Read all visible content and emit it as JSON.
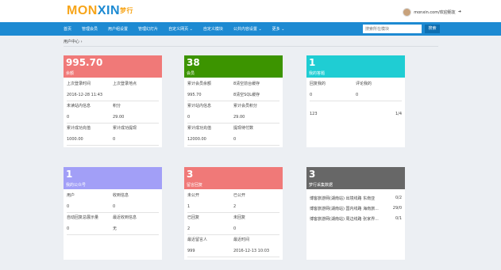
{
  "colors": {
    "nav": "#1d8ad2",
    "red": "#f07978",
    "green": "#3c9400",
    "teal": "#1fcdd3",
    "purple": "#a29ff7",
    "gray": "#676767"
  },
  "header": {
    "logo_part1": "MON",
    "logo_part2": "XIN",
    "logo_part3": "梦行",
    "user": "monxin.com/欢迎朋友",
    "user_icon": "logout-icon"
  },
  "nav": {
    "items": [
      "首页",
      "管理会员",
      "用户组设置",
      "管理幻灯片",
      "自定义网页 ⌄",
      "自定义模块",
      "公共内容设置 ⌄",
      "更多 ⌄"
    ],
    "search_placeholder": "搜索所在模块",
    "search_button": "搜索"
  },
  "breadcrumb": "用户中心 ›",
  "cards": [
    {
      "num": "995.70",
      "title": "余额",
      "color": "red",
      "rows": [
        [
          "上次登录时间",
          "上次登录地点"
        ],
        [
          "2016-12-28 11:43",
          ""
        ],
        [
          "未读站内信息",
          "积分"
        ],
        [
          "0",
          "29.00"
        ],
        [
          "累计成功充值",
          "累计成功提现"
        ],
        [
          "1000.00",
          "0"
        ]
      ]
    },
    {
      "num": "38",
      "title": "会员",
      "color": "green",
      "rows": [
        [
          "累计会员余额",
          "8清空前台缓存"
        ],
        [
          "995.70",
          "8清空SQL缓存"
        ],
        [
          "累计站内信息",
          "累计会员积分"
        ],
        [
          "0",
          "29.00"
        ],
        [
          "累计成功充值",
          "提现待付数"
        ],
        [
          "12000.00",
          "0"
        ]
      ]
    },
    {
      "num": "1",
      "title": "我的答题",
      "color": "teal",
      "rows": [
        [
          "回复我的",
          "评论我的"
        ],
        [
          "0",
          "0"
        ]
      ],
      "footer": [
        "123",
        "1/4"
      ]
    },
    {
      "num": "1",
      "title": "我的公众号",
      "color": "purple",
      "rows": [
        [
          "用户",
          "收到信息"
        ],
        [
          "0",
          "0"
        ],
        [
          "自动回复总展示量",
          "最近收到信息"
        ],
        [
          "0",
          "无"
        ]
      ]
    },
    {
      "num": "3",
      "title": "留言回复",
      "color": "red",
      "rows": [
        [
          "未公开",
          "已公开"
        ],
        [
          "1",
          "2"
        ],
        [
          "已回复",
          "未回复"
        ],
        [
          "2",
          "0"
        ],
        [
          "最近留言人",
          "最近时间"
        ],
        [
          "999",
          "2016-12-13 10:03"
        ]
      ]
    },
    {
      "num": "3",
      "title": "梦行采集数据",
      "color": "gray",
      "list": [
        [
          "博客旅游网(湖南站) 出境线路 东南亚",
          "0/2"
        ],
        [
          "博客旅游网(湖南站) 国内线路 海南旅...",
          "29/0"
        ],
        [
          "博客旅游网(湖南站) 周边线路 张家界...",
          "0/1"
        ]
      ]
    }
  ]
}
